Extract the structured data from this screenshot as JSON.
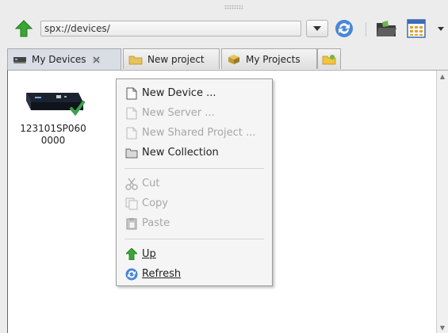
{
  "toolbar": {
    "path": "spx://devices/",
    "icons": [
      "up-arrow-icon",
      "dropdown-arrow-icon",
      "refresh-icon",
      "folder-icon",
      "grid-view-icon",
      "chevron-down-icon"
    ]
  },
  "tabs": [
    {
      "label": "My Devices",
      "active": true
    },
    {
      "label": "New project",
      "active": false
    },
    {
      "label": "My Projects",
      "active": false
    },
    {
      "label": "",
      "active": false
    }
  ],
  "devices": [
    {
      "label": "123101SP0600000",
      "line1": "123101SP060",
      "line2": "0000",
      "status": "online"
    }
  ],
  "context_menu": {
    "groups": [
      [
        {
          "label": "New Device ...",
          "icon": "document-icon",
          "enabled": true
        },
        {
          "label": "New Server ...",
          "icon": "document-icon",
          "enabled": false
        },
        {
          "label": "New Shared Project ...",
          "icon": "document-icon",
          "enabled": false
        },
        {
          "label": "New Collection",
          "icon": "folder-icon",
          "enabled": true
        }
      ],
      [
        {
          "label": "Cut",
          "icon": "scissors-icon",
          "enabled": false
        },
        {
          "label": "Copy",
          "icon": "copy-icon",
          "enabled": false
        },
        {
          "label": "Paste",
          "icon": "paste-icon",
          "enabled": false
        }
      ],
      [
        {
          "label": "Up",
          "icon": "up-arrow-icon",
          "enabled": true
        },
        {
          "label": "Refresh",
          "icon": "refresh-icon",
          "enabled": true
        }
      ]
    ]
  },
  "colors": {
    "accent": "#2f6fc6",
    "check": "#3ba14a",
    "up_arrow": "#3aa635"
  }
}
